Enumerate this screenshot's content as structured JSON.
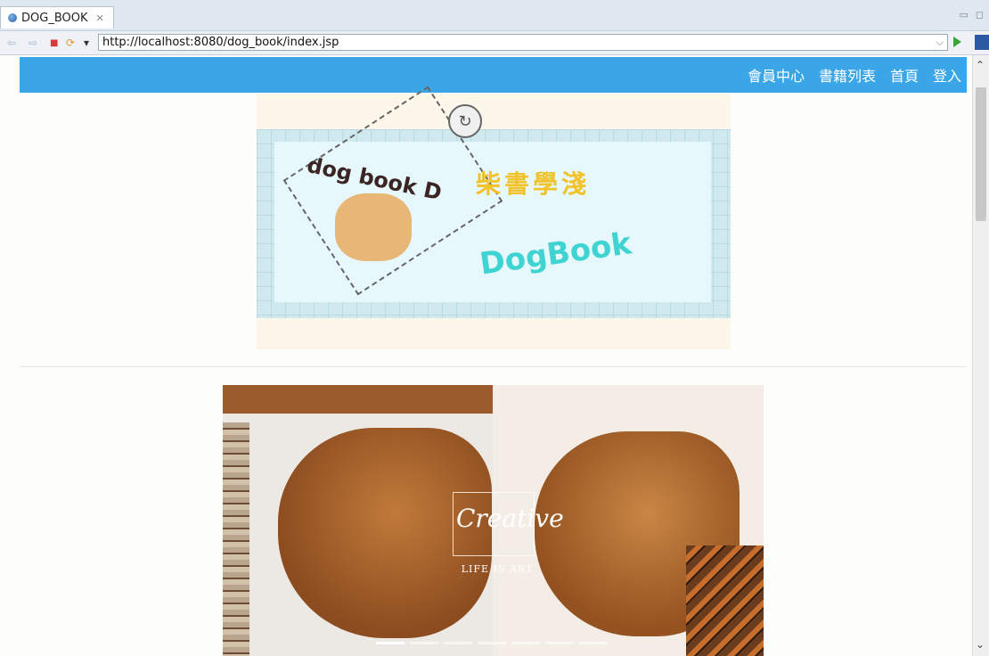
{
  "editor": {
    "tab_title": "DOG_BOOK",
    "tab_close": "✕",
    "minimize": "▭",
    "maximize": "◻"
  },
  "browser": {
    "back": "⇦",
    "forward": "⇨",
    "stop": "■",
    "refresh": "⟳",
    "menu": "▾",
    "url": "http://localhost:8080/dog_book/index.jsp",
    "url_dropdown": "⌵"
  },
  "site": {
    "nav": [
      "會員中心",
      "書籍列表",
      "首頁",
      "登入"
    ],
    "logo": {
      "title": "dog book D",
      "chinese_title": "柴書學淺",
      "brand": "DogBook"
    },
    "carousel": {
      "script_text": "Creative",
      "tagline": "LIFE IS ART",
      "slides": 7,
      "active_slide": 1
    }
  },
  "colors": {
    "header_bg": "#3aa6e7",
    "page_bg": "#fdfefb",
    "tabbar_bg": "#dfe7f1"
  },
  "scrollbar": {
    "up": "⌃",
    "down": "⌄"
  }
}
